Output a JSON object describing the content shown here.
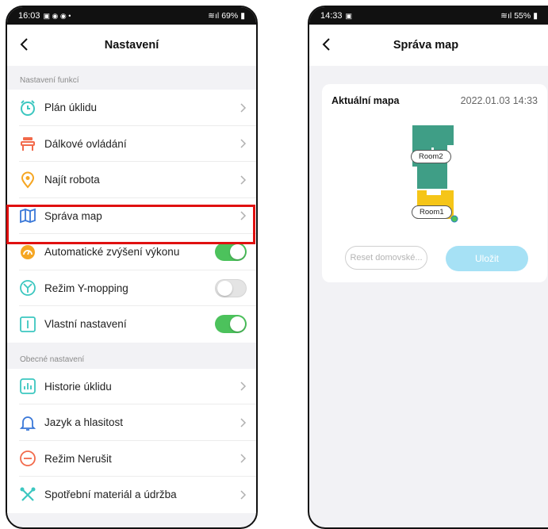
{
  "left": {
    "status": {
      "time": "16:03",
      "battery": "69%"
    },
    "title": "Nastavení",
    "section1": "Nastavení funkcí",
    "items": [
      {
        "label": "Plán úklidu",
        "icon": "alarm-clock-icon",
        "control": "chevron"
      },
      {
        "label": "Dálkové ovládání",
        "icon": "remote-control-icon",
        "control": "chevron"
      },
      {
        "label": "Najít robota",
        "icon": "location-pin-icon",
        "control": "chevron"
      },
      {
        "label": "Správa map",
        "icon": "map-icon",
        "control": "chevron",
        "highlighted": true
      },
      {
        "label": "Automatické zvýšení výkonu",
        "icon": "power-boost-icon",
        "control": "toggle",
        "on": true
      },
      {
        "label": "Režim Y-mopping",
        "icon": "y-mop-icon",
        "control": "toggle",
        "on": false
      },
      {
        "label": "Vlastní nastavení",
        "icon": "custom-settings-icon",
        "control": "toggle",
        "on": true
      }
    ],
    "section2": "Obecné nastavení",
    "items2": [
      {
        "label": "Historie úklidu",
        "icon": "history-chart-icon",
        "control": "chevron"
      },
      {
        "label": "Jazyk a hlasitost",
        "icon": "bell-icon",
        "control": "chevron"
      },
      {
        "label": "Režim Nerušit",
        "icon": "do-not-disturb-icon",
        "control": "chevron"
      },
      {
        "label": "Spotřební materiál a údržba",
        "icon": "maintenance-icon",
        "control": "chevron"
      }
    ]
  },
  "right": {
    "status": {
      "time": "14:33",
      "battery": "55%"
    },
    "title": "Správa map",
    "card": {
      "title": "Aktuální mapa",
      "date": "2022.01.03 14:33",
      "rooms": [
        "Room2",
        "Room1"
      ],
      "reset_label": "Reset domovské...",
      "save_label": "Uložit"
    }
  },
  "colors": {
    "accent": "#f5a623",
    "toggle_on": "#4cc25c",
    "highlight": "#e01010",
    "save_button": "#a6e1f5",
    "room2": "#3f9e86",
    "room1": "#f5c518"
  }
}
